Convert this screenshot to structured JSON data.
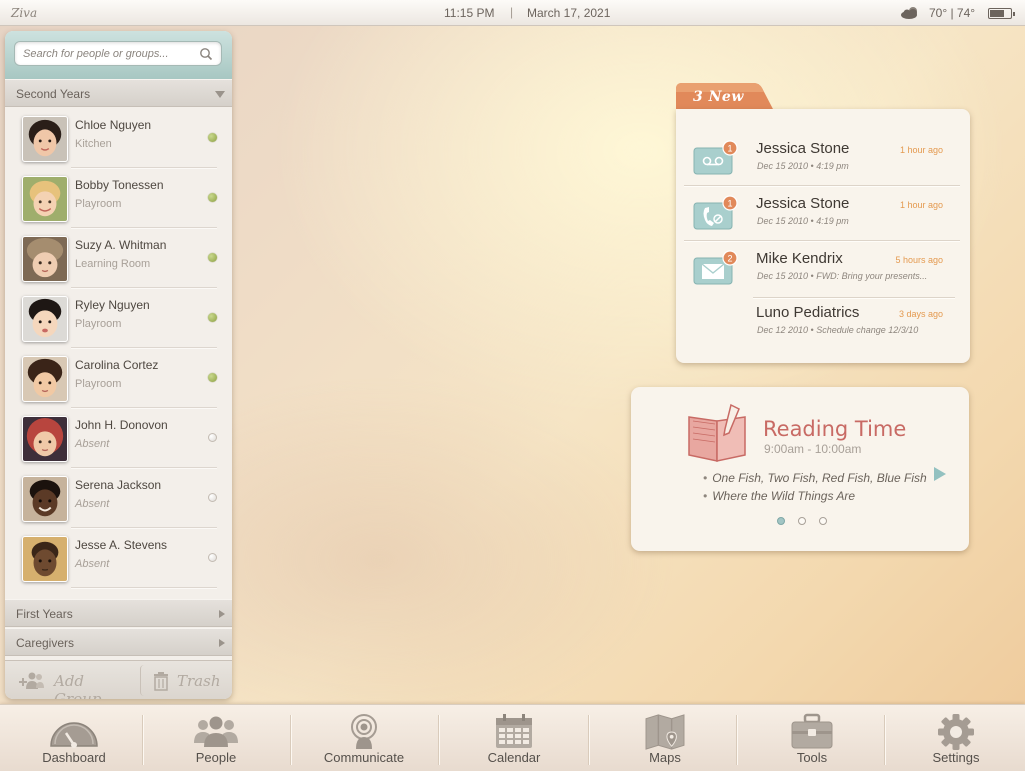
{
  "statusbar": {
    "app_name": "Ziva",
    "time": "11:15 PM",
    "separator": "|",
    "date": "March 17, 2021",
    "weather_icon": "cloud-icon",
    "temperature": "70° | 74°",
    "battery_icon": "battery-icon"
  },
  "sidebar": {
    "search_placeholder": "Search for people or groups...",
    "search_icon": "search-icon",
    "current_group": "Second Years",
    "people": [
      {
        "name": "Chloe Nguyen",
        "location": "Kitchen",
        "status": "online"
      },
      {
        "name": "Bobby Tonessen",
        "location": "Playroom",
        "status": "online"
      },
      {
        "name": "Suzy A. Whitman",
        "location": "Learning Room",
        "status": "online"
      },
      {
        "name": "Ryley Nguyen",
        "location": "Playroom",
        "status": "online"
      },
      {
        "name": "Carolina Cortez",
        "location": "Playroom",
        "status": "online"
      },
      {
        "name": "John H. Donovon",
        "location": "Absent",
        "status": "offline"
      },
      {
        "name": "Serena Jackson",
        "location": "Absent",
        "status": "offline"
      },
      {
        "name": "Jesse A. Stevens",
        "location": "Absent",
        "status": "offline"
      }
    ],
    "groups": [
      {
        "label": "First Years"
      },
      {
        "label": "Caregivers"
      }
    ],
    "add_group_label": "Add Group",
    "trash_label": "Trash"
  },
  "messages": {
    "new_badge": "3 New",
    "items": [
      {
        "type": "voicemail",
        "icon": "voicemail-icon",
        "count": "1",
        "from": "Jessica Stone",
        "ago": "1 hour ago",
        "meta": "Dec 15 2010  • 4:19 pm"
      },
      {
        "type": "missed-call",
        "icon": "missed-call-icon",
        "count": "1",
        "from": "Jessica Stone",
        "ago": "1 hour ago",
        "meta": "Dec 15 2010  • 4:19 pm"
      },
      {
        "type": "mail",
        "icon": "mail-icon",
        "count": "2",
        "from": "Mike Kendrix",
        "ago": "5 hours ago",
        "meta": "Dec 15 2010  •  FWD: Bring your presents..."
      },
      {
        "type": "mail",
        "icon": "",
        "count": "",
        "from": "Luno Pediatrics",
        "ago": "3 days ago",
        "meta": "Dec 12 2010  •  Schedule change 12/3/10"
      }
    ]
  },
  "reading": {
    "title": "Reading Time",
    "time": "9:00am - 10:00am",
    "books": [
      "One Fish, Two Fish, Red Fish, Blue Fish",
      "Where the Wild Things Are"
    ],
    "page_count": 3,
    "active_page": 0
  },
  "nav": [
    {
      "label": "Dashboard",
      "icon": "dashboard-icon"
    },
    {
      "label": "People",
      "icon": "people-icon"
    },
    {
      "label": "Communicate",
      "icon": "communicate-icon"
    },
    {
      "label": "Calendar",
      "icon": "calendar-icon"
    },
    {
      "label": "Maps",
      "icon": "maps-icon"
    },
    {
      "label": "Tools",
      "icon": "tools-icon"
    },
    {
      "label": "Settings",
      "icon": "settings-icon"
    }
  ],
  "colors": {
    "accent_teal": "#a7c7c2",
    "badge_orange": "#e1895a",
    "reading_title": "#c86a64",
    "online_green": "#8da043"
  }
}
